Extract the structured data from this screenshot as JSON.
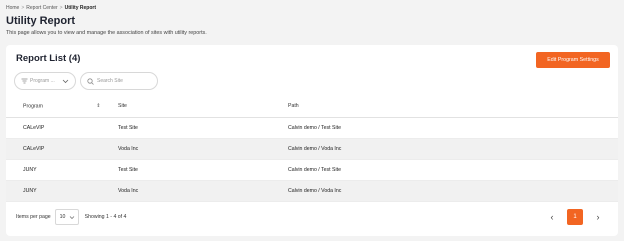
{
  "breadcrumb": {
    "items": [
      "Home",
      "Report Center",
      "Utility Report"
    ],
    "separator": ">"
  },
  "page": {
    "title": "Utility Report",
    "subtitle": "This page allows you to view and manage the association of sites with utility reports."
  },
  "card": {
    "title": "Report List (4)",
    "edit_button": "Edit Program Settings"
  },
  "filters": {
    "program_label": "Program ...",
    "search_placeholder": "Search Site"
  },
  "table": {
    "headers": [
      "Program",
      "Site",
      "Path"
    ],
    "rows": [
      {
        "program": "CALeVIP",
        "site": "Test Site",
        "path": "Calvin demo / Test Site"
      },
      {
        "program": "CALeVIP",
        "site": "Voda Inc",
        "path": "Calvin demo / Voda Inc"
      },
      {
        "program": "JUNY",
        "site": "Test Site",
        "path": "Calvin demo / Test Site"
      },
      {
        "program": "JUNY",
        "site": "Voda Inc",
        "path": "Calvin demo / Voda Inc"
      }
    ]
  },
  "footer": {
    "items_per_page_label": "Items per page",
    "items_per_page_value": "10",
    "showing": "Showing 1 - 4 of 4"
  },
  "pagination": {
    "prev": "‹",
    "current_page": "1",
    "next": "›"
  },
  "colors": {
    "accent": "#f26522"
  },
  "icons": [
    "filter-icon",
    "chevron-down-icon",
    "search-icon",
    "sort-icon",
    "chevron-left-icon",
    "chevron-right-icon"
  ]
}
